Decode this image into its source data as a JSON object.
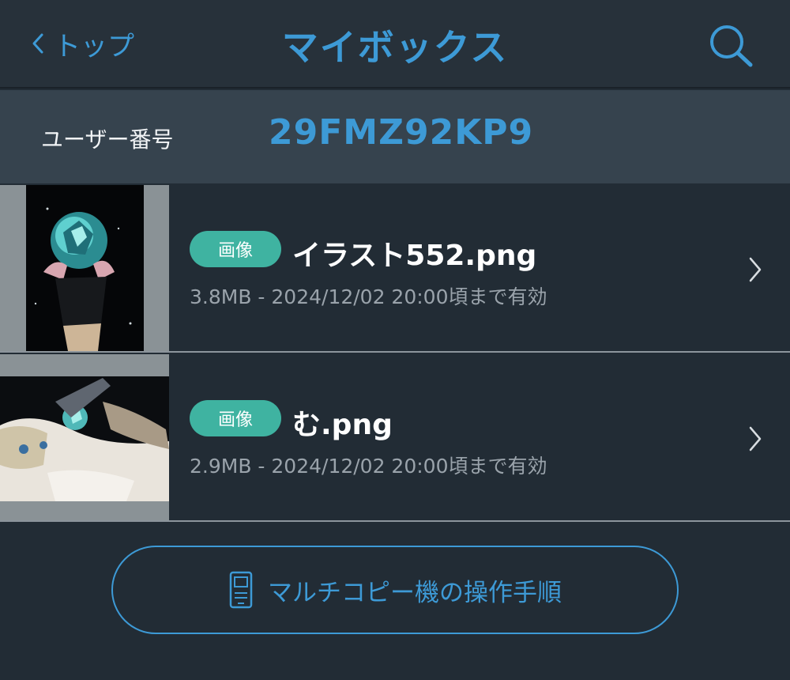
{
  "nav": {
    "back_label": "トップ",
    "title": "マイボックス"
  },
  "user": {
    "label": "ユーザー番号",
    "number": "29FMZ92KP9"
  },
  "files": [
    {
      "type_badge": "画像",
      "name": "イラスト552.png",
      "meta": "3.8MB - 2024/12/02 20:00頃まで有効"
    },
    {
      "type_badge": "画像",
      "name": "む.png",
      "meta": "2.9MB - 2024/12/02 20:00頃まで有効"
    }
  ],
  "manual_button": {
    "label": "マルチコピー機の操作手順",
    "icon": "copier-icon"
  },
  "colors": {
    "accent": "#3d9ad6",
    "badge": "#3fb3a1",
    "background": "#222c35",
    "band": "#36434e"
  }
}
